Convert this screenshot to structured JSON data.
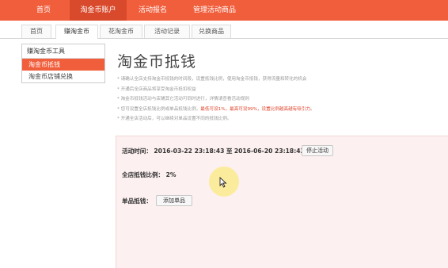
{
  "topnav": {
    "items": [
      {
        "label": "首页"
      },
      {
        "label": "淘金币账户"
      },
      {
        "label": "活动报名"
      },
      {
        "label": "管理活动商品"
      }
    ]
  },
  "subtabs": [
    {
      "label": "首页"
    },
    {
      "label": "赚淘金币"
    },
    {
      "label": "花淘金币"
    },
    {
      "label": "活动记录"
    },
    {
      "label": "兑换商品"
    }
  ],
  "sidebar": {
    "title": "赚淘金币工具",
    "items": [
      {
        "label": "淘金币抵钱"
      },
      {
        "label": "淘金币店铺兑换"
      }
    ]
  },
  "main": {
    "title": "淘金币抵钱",
    "tips": [
      {
        "text": "请确认全店支持淘金币抵钱的时间段，设置抵钱比例，使用淘金币抵钱，获得流量和转化的机会"
      },
      {
        "text": "开通后全店商品将享受淘金币抵扣权益",
        "red": ""
      },
      {
        "text": "淘金币抵钱活动与店铺其它活动可同时进行，详情请查看活动规则"
      },
      {
        "text": "您可设置全店抵钱比例或单品抵钱比例，",
        "red": "最低可设1%，最高可设99%，设置比例越高越有吸引力。"
      },
      {
        "text": "开通全店活动后，可以继续对单品设置不同的抵钱比例。"
      }
    ],
    "activity_time": {
      "label": "活动时间：",
      "start": "2016-03-22 23:18:43",
      "separator": "至",
      "end": "2016-06-20 23:18:43",
      "stop_button": "停止活动"
    },
    "store_ratio": {
      "label": "全店抵钱比例：",
      "value": "2%"
    },
    "single_item": {
      "label": "单品抵钱：",
      "add_button": "添加单品"
    }
  }
}
